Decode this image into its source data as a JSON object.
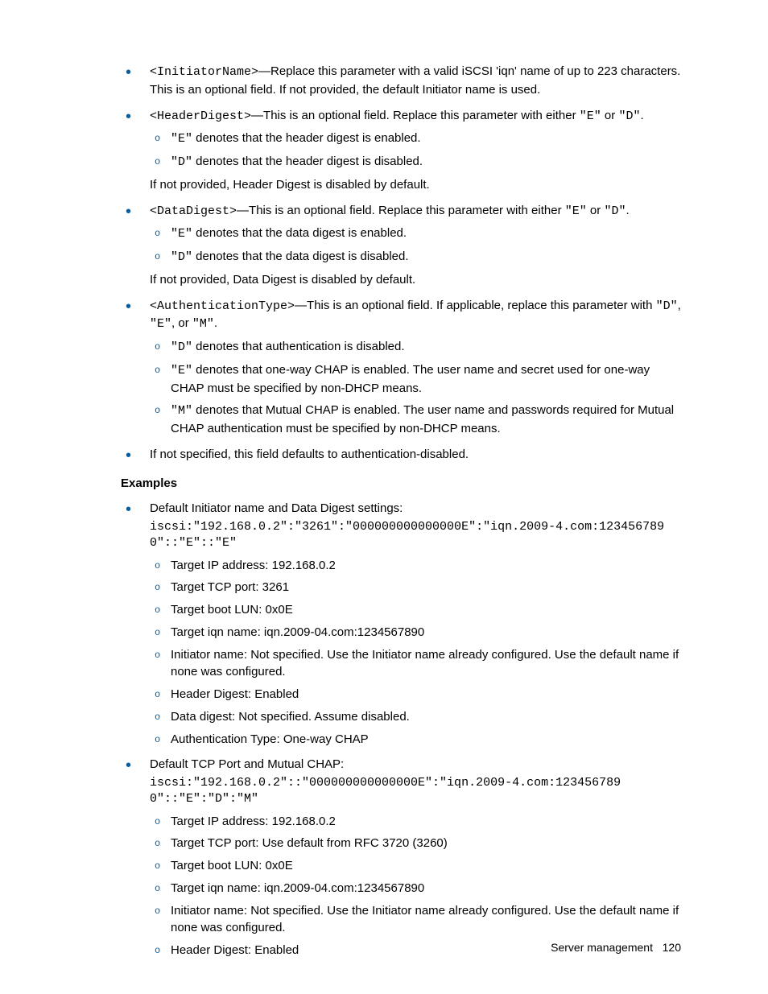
{
  "items": [
    {
      "prefix_mono": "<InitiatorName>",
      "text_after": "—Replace this parameter with a valid iSCSI 'iqn' name of up to 223 characters. This is an optional field. If not provided, the default Initiator name is used."
    },
    {
      "prefix_mono": "<HeaderDigest>",
      "text_after_parts": [
        "—This is an optional field. Replace this parameter with either ",
        "\"E\"",
        " or ",
        "\"D\"",
        "."
      ],
      "sub": [
        {
          "parts": [
            "\"E\"",
            " denotes that the header digest is enabled."
          ]
        },
        {
          "parts": [
            "\"D\"",
            " denotes that the header digest is disabled."
          ]
        }
      ],
      "tail": "If not provided, Header Digest is disabled by default."
    },
    {
      "prefix_mono": "<DataDigest>",
      "text_after_parts": [
        "—This is an optional field. Replace this parameter with either ",
        "\"E\"",
        " or ",
        "\"D\"",
        "."
      ],
      "sub": [
        {
          "parts": [
            "\"E\"",
            " denotes that the data digest is enabled."
          ]
        },
        {
          "parts": [
            "\"D\"",
            " denotes that the data digest is disabled."
          ]
        }
      ],
      "tail": "If not provided, Data Digest is disabled by default."
    },
    {
      "prefix_mono": "<AuthenticationType>",
      "text_after_parts": [
        "—This is an optional field. If applicable, replace this parameter with ",
        "\"D\"",
        ", ",
        "\"E\"",
        ", or ",
        "\"M\"",
        "."
      ],
      "sub": [
        {
          "parts": [
            "\"D\"",
            " denotes that authentication is disabled."
          ]
        },
        {
          "parts": [
            "\"E\"",
            " denotes that one-way CHAP is enabled. The user name and secret used for one-way CHAP must be specified by non-DHCP means."
          ]
        },
        {
          "parts": [
            "\"M\"",
            " denotes that Mutual CHAP is enabled. The user name and passwords required for Mutual CHAP authentication must be specified by non-DHCP means."
          ]
        }
      ]
    },
    {
      "plain": "If not specified, this field defaults to authentication-disabled."
    }
  ],
  "examples_heading": "Examples",
  "examples": [
    {
      "intro": "Default Initiator name and Data Digest settings:",
      "code": "iscsi:\"192.168.0.2\":\"3261\":\"000000000000000E\":\"iqn.2009-4.com:1234567890\"::\"E\"::\"E\"",
      "sub": [
        "Target IP address: 192.168.0.2",
        "Target TCP port: 3261",
        "Target boot LUN: 0x0E",
        "Target iqn name: iqn.2009-04.com:1234567890",
        "Initiator name: Not specified. Use the Initiator name already configured. Use the default name if none was configured.",
        "Header Digest: Enabled",
        "Data digest: Not specified. Assume disabled.",
        "Authentication Type: One-way CHAP"
      ]
    },
    {
      "intro": "Default TCP Port and Mutual CHAP:",
      "code": "iscsi:\"192.168.0.2\"::\"000000000000000E\":\"iqn.2009-4.com:1234567890\"::\"E\":\"D\":\"M\"",
      "sub": [
        "Target IP address: 192.168.0.2",
        "Target TCP port: Use default from RFC 3720 (3260)",
        "Target boot LUN: 0x0E",
        "Target iqn name: iqn.2009-04.com:1234567890",
        "Initiator name: Not specified. Use the Initiator name already configured. Use the default name if none was configured.",
        "Header Digest: Enabled"
      ]
    }
  ],
  "footer": {
    "section": "Server management",
    "page": "120"
  }
}
